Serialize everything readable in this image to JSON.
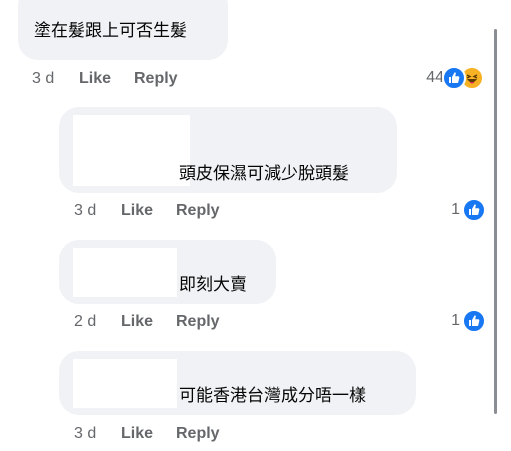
{
  "top_comment": {
    "text": "塗在髮跟上可否生髮",
    "time": "3 d",
    "like_label": "Like",
    "reply_label": "Reply",
    "reaction_count": "44",
    "reaction_icons": [
      "like-icon",
      "haha-icon"
    ]
  },
  "replies": [
    {
      "text": "頭皮保濕可減少脫頭髮",
      "time": "3 d",
      "like_label": "Like",
      "reply_label": "Reply",
      "reaction_count": "1",
      "reaction_icons": [
        "like-icon"
      ]
    },
    {
      "text": "即刻大賣",
      "time": "2 d",
      "like_label": "Like",
      "reply_label": "Reply",
      "reaction_count": "1",
      "reaction_icons": [
        "like-icon"
      ]
    },
    {
      "text": "可能香港台灣成分唔一樣",
      "time": "3 d",
      "like_label": "Like",
      "reply_label": "Reply"
    }
  ],
  "colors": {
    "bubble": "#f0f2f5",
    "meta_text": "#65676b",
    "like_blue": "#1877f2",
    "haha_yellow": "#f7b125",
    "scrollbar": "#8a8d91"
  }
}
